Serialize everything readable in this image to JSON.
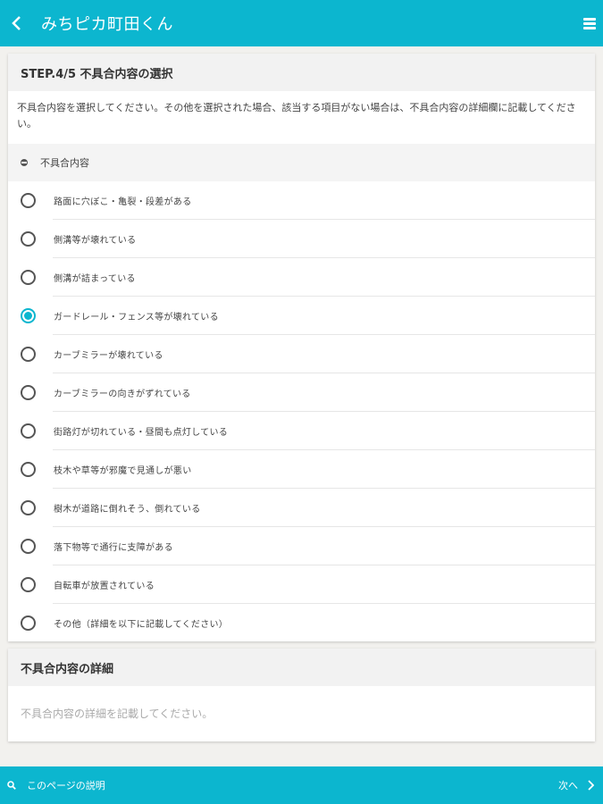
{
  "header": {
    "title": "みちピカ町田くん"
  },
  "step": {
    "title": "STEP.4/5 不具合内容の選択",
    "description": "不具合内容を選択してください。その他を選択された場合、該当する項目がない場合は、不具合内容の詳細欄に記載してください。",
    "section_label": "不具合内容",
    "options": [
      {
        "label": "路面に穴ぼこ・亀裂・段差がある",
        "selected": false
      },
      {
        "label": "側溝等が壊れている",
        "selected": false
      },
      {
        "label": "側溝が詰まっている",
        "selected": false
      },
      {
        "label": "ガードレール・フェンス等が壊れている",
        "selected": true
      },
      {
        "label": "カーブミラーが壊れている",
        "selected": false
      },
      {
        "label": "カーブミラーの向きがずれている",
        "selected": false
      },
      {
        "label": "街路灯が切れている・昼間も点灯している",
        "selected": false
      },
      {
        "label": "枝木や草等が邪魔で見通しが悪い",
        "selected": false
      },
      {
        "label": "樹木が道路に倒れそう、倒れている",
        "selected": false
      },
      {
        "label": "落下物等で通行に支障がある",
        "selected": false
      },
      {
        "label": "自転車が放置されている",
        "selected": false
      },
      {
        "label": "その他（詳細を以下に記載してください）",
        "selected": false
      }
    ]
  },
  "detail": {
    "title": "不具合内容の詳細",
    "value": "",
    "placeholder": "不具合内容の詳細を記載してください。"
  },
  "footer": {
    "help_label": "このページの説明",
    "next_label": "次へ"
  },
  "colors": {
    "accent": "#0cb6cf",
    "background": "#f2f1ee"
  },
  "icons": {
    "back": "chevron-left-icon",
    "menu": "hamburger-icon",
    "help": "search-icon",
    "next": "chevron-right-icon"
  }
}
